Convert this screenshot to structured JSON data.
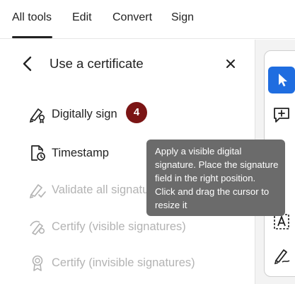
{
  "topnav": {
    "tabs": [
      {
        "label": "All tools"
      },
      {
        "label": "Edit"
      },
      {
        "label": "Convert"
      },
      {
        "label": "Sign"
      }
    ]
  },
  "panel": {
    "title": "Use a certificate",
    "items": [
      {
        "label": "Digitally sign",
        "icon": "digital-sign-icon",
        "enabled": true
      },
      {
        "label": "Timestamp",
        "icon": "timestamp-icon",
        "enabled": true
      },
      {
        "label": "Validate all signatu",
        "icon": "validate-signature-icon",
        "enabled": false
      },
      {
        "label": "Certify (visible signatures)",
        "icon": "certify-visible-icon",
        "enabled": false
      },
      {
        "label": "Certify (invisible signatures)",
        "icon": "certify-invisible-icon",
        "enabled": false
      }
    ]
  },
  "badge": {
    "text": "4"
  },
  "tooltip": {
    "lines": [
      "Apply a visible digital",
      "signature. Place the signature",
      "field in the right position.",
      "Click and drag the cursor to",
      "resize it"
    ]
  },
  "toolrail": {
    "tools": [
      {
        "icon": "select-cursor-icon",
        "active": true
      },
      {
        "icon": "add-comment-icon",
        "active": false
      },
      {
        "icon": "text-box-icon",
        "active": false
      },
      {
        "icon": "draw-signature-icon",
        "active": false
      }
    ]
  },
  "colors": {
    "accent": "#1f6de0",
    "badge": "#7b1515",
    "tooltip_bg": "#6b6b6b",
    "disabled_text": "#b3b3b3"
  }
}
